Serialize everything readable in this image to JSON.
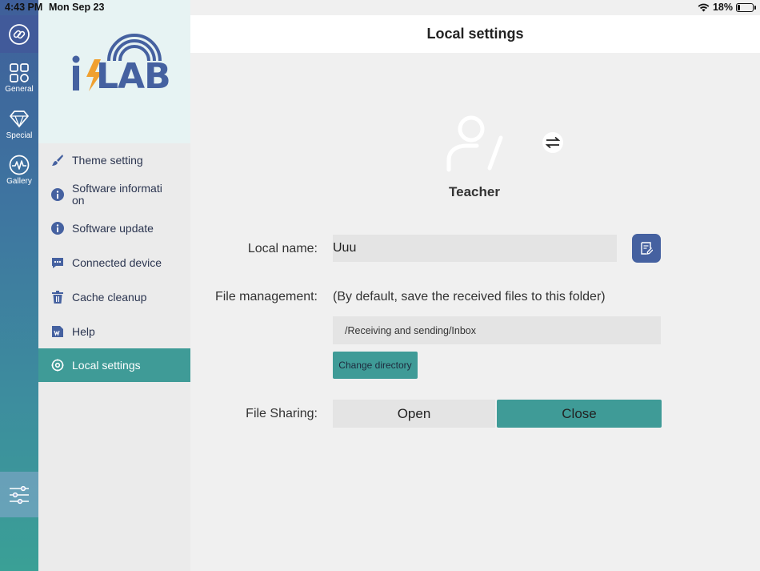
{
  "status_bar": {
    "time": "4:43 PM",
    "date": "Mon Sep 23",
    "battery": "18%",
    "battery_level": 0.18
  },
  "rail": {
    "items": [
      {
        "label": "General",
        "icon": "grid-icon"
      },
      {
        "label": "Special",
        "icon": "diamond-icon"
      },
      {
        "label": "Gallery",
        "icon": "wave-icon"
      }
    ]
  },
  "logo": {
    "text_i": "i",
    "text_lab": "LAB"
  },
  "menu": {
    "items": [
      {
        "label": "Theme setting",
        "icon": "brush-icon"
      },
      {
        "label": "Software informati on",
        "line1": "Software informati",
        "line2": "on",
        "icon": "info-icon"
      },
      {
        "label": "Software update",
        "icon": "info-icon"
      },
      {
        "label": "Connected device",
        "icon": "chat-icon"
      },
      {
        "label": "Cache cleanup",
        "icon": "trash-icon"
      },
      {
        "label": "Help",
        "icon": "document-icon"
      },
      {
        "label": "Local settings",
        "icon": "gear-icon"
      }
    ]
  },
  "page": {
    "title": "Local settings",
    "role": "Teacher",
    "local_name_label": "Local name:",
    "local_name_value": "Uuu",
    "file_management_label": "File management:",
    "file_management_note": "(By default, save the received files to this folder)",
    "directory_path": "/Receiving and sending/Inbox",
    "change_directory_label": "Change directory",
    "file_sharing_label": "File  Sharing:",
    "sharing_open": "Open",
    "sharing_close": "Close",
    "sharing_selected": "Close"
  },
  "colors": {
    "accent": "#3f9b97",
    "brand_blue": "#4561a0",
    "logo_orange": "#f0a030"
  }
}
